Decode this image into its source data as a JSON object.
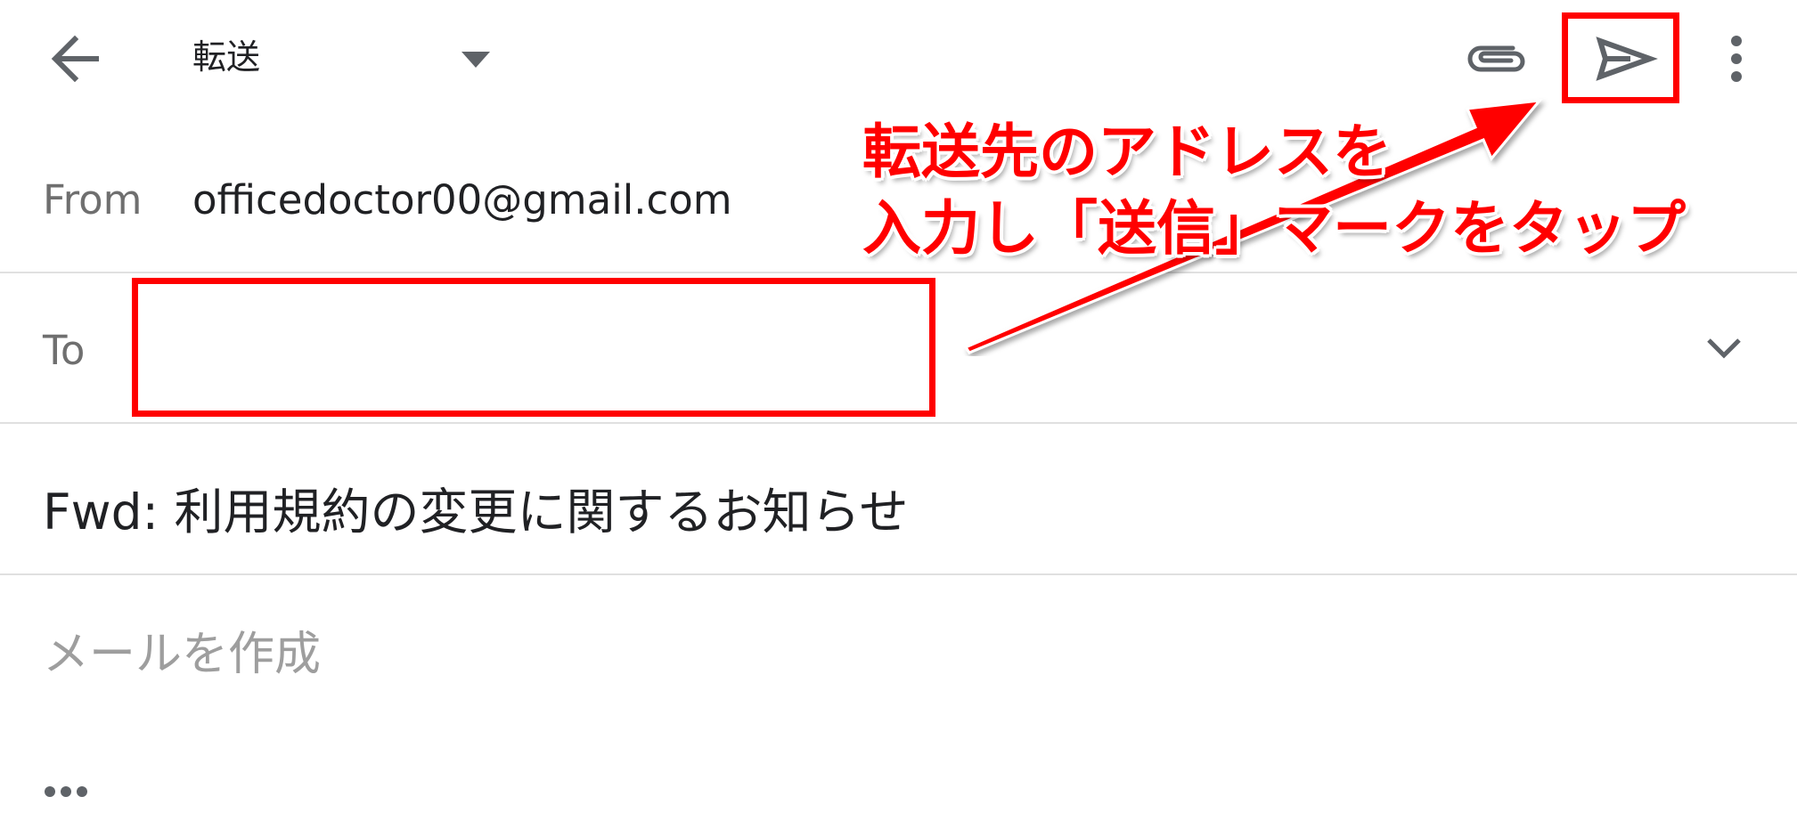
{
  "header": {
    "title": "転送",
    "icons": {
      "back": "arrow-left-icon",
      "dropdown": "caret-down-icon",
      "attach": "paperclip-icon",
      "send": "send-icon",
      "more": "more-vert-icon"
    }
  },
  "from": {
    "label": "From",
    "value": "officedoctor00@gmail.com"
  },
  "to": {
    "label": "To",
    "value": "",
    "placeholder": ""
  },
  "subject": {
    "value": "Fwd: 利用規約の変更に関するお知らせ"
  },
  "body": {
    "placeholder": "メールを作成"
  },
  "annotation": {
    "line1": "転送先のアドレスを",
    "line2": "入力し「送信」マークをタップ",
    "color": "#ff0000"
  },
  "colors": {
    "icon": "#5f6368",
    "divider": "#e0e0e0",
    "annotation": "#ff0000"
  }
}
